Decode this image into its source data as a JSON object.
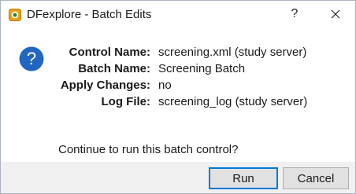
{
  "window": {
    "title": "DFexplore - Batch Edits",
    "help_glyph": "?",
    "icons": {
      "app": "dfexplore-app-icon",
      "question": "question-icon",
      "close": "close-icon"
    }
  },
  "details": [
    {
      "label": "Control Name:",
      "value": "screening.xml (study server)"
    },
    {
      "label": "Batch Name:",
      "value": "Screening Batch"
    },
    {
      "label": "Apply Changes:",
      "value": "no"
    },
    {
      "label": "Log File:",
      "value": "screening_log (study server)"
    }
  ],
  "prompt": "Continue to run this batch control?",
  "buttons": {
    "run": "Run",
    "cancel": "Cancel"
  },
  "colors": {
    "accent": "#0078d7",
    "question_icon": "#2166c1",
    "footer_bg": "#f0f0f0"
  }
}
